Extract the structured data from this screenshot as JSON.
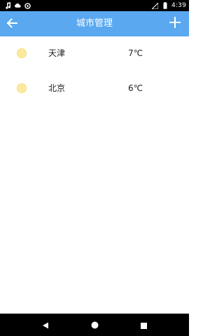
{
  "status_bar": {
    "time": "4:39",
    "icons_left": [
      "music-note-icon",
      "cloud-icon",
      "sync-icon"
    ],
    "icons_right": [
      "signal-icon",
      "battery-icon"
    ]
  },
  "app_bar": {
    "title": "城市管理",
    "back_icon": "arrow-left-icon",
    "add_icon": "plus-icon",
    "color": "#5aa8ef"
  },
  "cities": [
    {
      "name": "天津",
      "temp": "7℃",
      "weather_icon": "sunny-icon"
    },
    {
      "name": "北京",
      "temp": "6℃",
      "weather_icon": "sunny-icon"
    }
  ],
  "nav_bar": {
    "buttons": [
      "back-triangle-icon",
      "home-circle-icon",
      "recents-square-icon"
    ]
  }
}
